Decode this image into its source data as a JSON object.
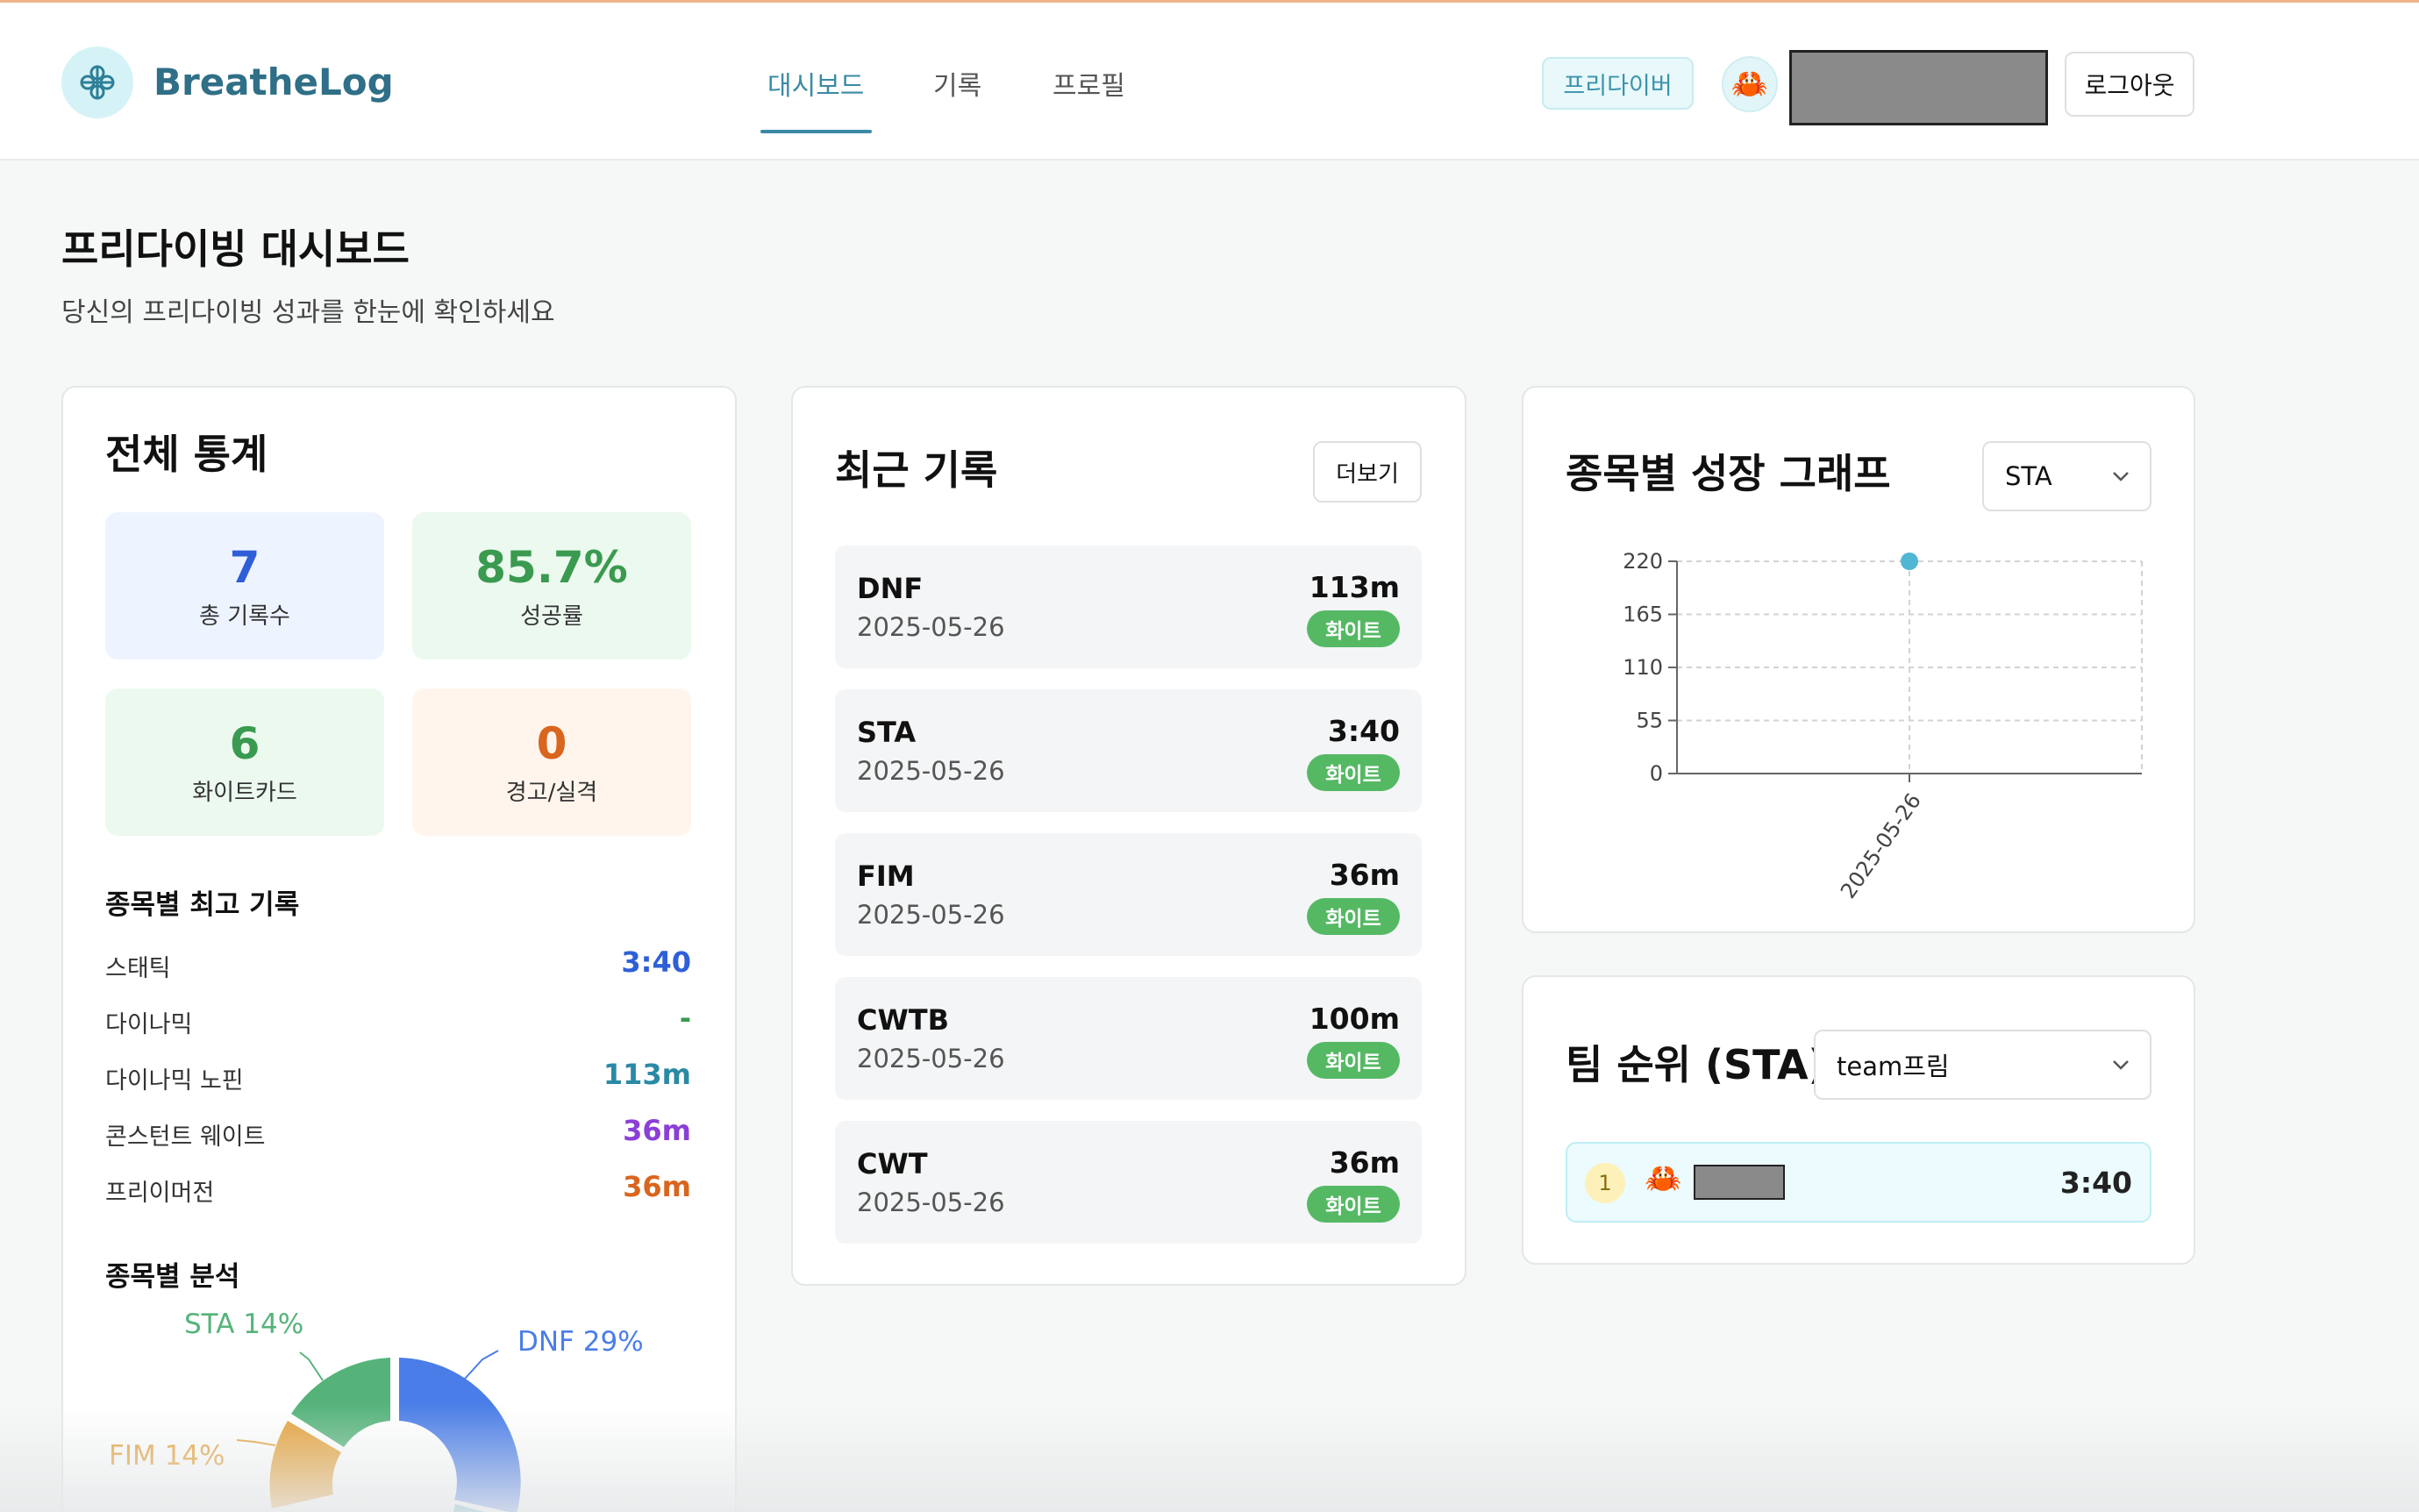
{
  "app": {
    "name": "BreatheLog",
    "logo_icon": "flower-icon"
  },
  "nav": {
    "items": [
      "대시보드",
      "기록",
      "프로필"
    ],
    "active": "대시보드"
  },
  "user": {
    "role": "프리다이버",
    "avatar_icon": "crab-icon",
    "logout_label": "로그아웃"
  },
  "page": {
    "title": "프리다이빙 대시보드",
    "subtitle": "당신의 프리다이빙 성과를 한눈에 확인하세요"
  },
  "stats": {
    "title": "전체 통계",
    "total": {
      "value": "7",
      "label": "총 기록수",
      "color": "#2f5fd7",
      "bg": "#eef4ff"
    },
    "success": {
      "value": "85.7%",
      "label": "성공률",
      "color": "#3a9a4f",
      "bg": "#ecf9ef"
    },
    "white": {
      "value": "6",
      "label": "화이트카드",
      "color": "#3a9a4f",
      "bg": "#ecf9ef"
    },
    "warn": {
      "value": "0",
      "label": "경고/실격",
      "color": "#d9651e",
      "bg": "#fff5ec"
    }
  },
  "best": {
    "title": "종목별 최고 기록",
    "rows": [
      {
        "name": "스태틱",
        "value": "3:40",
        "color": "#2f5fd7"
      },
      {
        "name": "다이나믹",
        "value": "-",
        "color": "#3a9a4f"
      },
      {
        "name": "다이나믹 노핀",
        "value": "113m",
        "color": "#2a8aa5"
      },
      {
        "name": "콘스턴트 웨이트",
        "value": "36m",
        "color": "#8a3fd6"
      },
      {
        "name": "프리이머전",
        "value": "36m",
        "color": "#d9651e"
      }
    ]
  },
  "analysis": {
    "title": "종목별 분석",
    "labels": [
      {
        "text": "STA 14%",
        "color": "#55b37a"
      },
      {
        "text": "DNF 29%",
        "color": "#4a7de8"
      },
      {
        "text": "FIM 14%",
        "color": "#e5a23a"
      }
    ]
  },
  "recent": {
    "title": "최근 기록",
    "more_label": "더보기",
    "items": [
      {
        "discipline": "DNF",
        "date": "2025-05-26",
        "performance": "113m",
        "card": "화이트"
      },
      {
        "discipline": "STA",
        "date": "2025-05-26",
        "performance": "3:40",
        "card": "화이트"
      },
      {
        "discipline": "FIM",
        "date": "2025-05-26",
        "performance": "36m",
        "card": "화이트"
      },
      {
        "discipline": "CWTB",
        "date": "2025-05-26",
        "performance": "100m",
        "card": "화이트"
      },
      {
        "discipline": "CWT",
        "date": "2025-05-26",
        "performance": "36m",
        "card": "화이트"
      }
    ]
  },
  "growth": {
    "title": "종목별 성장 그래프",
    "select_value": "STA"
  },
  "chart_data": {
    "type": "scatter",
    "x": [
      "2025-05-26"
    ],
    "y": [
      220
    ],
    "yticks": [
      0,
      55,
      110,
      165,
      220
    ],
    "ylim": [
      0,
      220
    ],
    "grid": true,
    "point_color": "#4fb6d3"
  },
  "ranking": {
    "title": "팀 순위 (STA)",
    "team_select": "team프림",
    "rows": [
      {
        "rank": "1",
        "icon": "crab-icon",
        "time": "3:40"
      }
    ]
  }
}
